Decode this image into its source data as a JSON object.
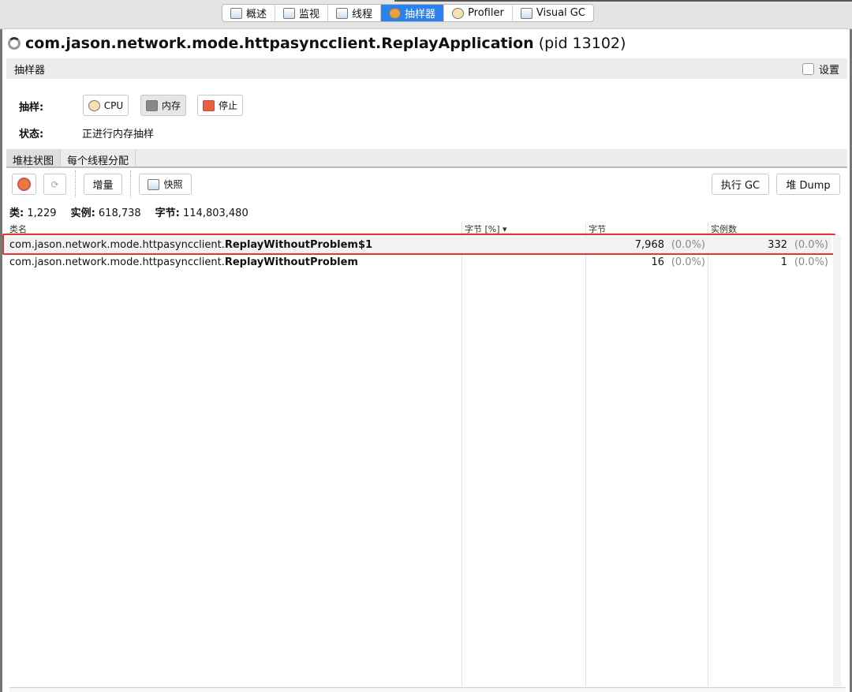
{
  "tabs": [
    {
      "label": "概述",
      "icon": "overview-icon"
    },
    {
      "label": "监视",
      "icon": "monitor-icon"
    },
    {
      "label": "线程",
      "icon": "threads-icon"
    },
    {
      "label": "抽样器",
      "icon": "sampler-icon",
      "active": true
    },
    {
      "label": "Profiler",
      "icon": "profiler-icon"
    },
    {
      "label": "Visual GC",
      "icon": "visualgc-icon"
    }
  ],
  "app": {
    "name": "com.jason.network.mode.httpasyncclient.ReplayApplication",
    "pid": "(pid 13102)"
  },
  "sampler": {
    "header": "抽样器",
    "settings_label": "设置",
    "sample_label": "抽样:",
    "cpu": "CPU",
    "memory": "内存",
    "stop": "停止",
    "status_label": "状态:",
    "status_value": "正进行内存抽样"
  },
  "subtabs": [
    "堆柱状图",
    "每个线程分配"
  ],
  "toolbar": {
    "delta": "增量",
    "snapshot": "快照",
    "gc": "执行 GC",
    "heap_dump": "堆 Dump"
  },
  "stats": {
    "classes_label": "类:",
    "classes": "1,229",
    "instances_label": "实例:",
    "instances": "618,738",
    "bytes_label": "字节:",
    "bytes": "114,803,480"
  },
  "table": {
    "columns": [
      "类名",
      "字节 [%] ▾",
      "字节",
      "实例数"
    ],
    "rows": [
      {
        "pkg": "com.jason.network.mode.httpasyncclient.",
        "cls": "ReplayWithoutProblem$1",
        "bytes": "7,968",
        "bytes_pct": "(0.0%)",
        "instances": "332",
        "inst_pct": "(0.0%)"
      },
      {
        "pkg": "com.jason.network.mode.httpasyncclient.",
        "cls": "ReplayWithoutProblem",
        "bytes": "16",
        "bytes_pct": "(0.0%)",
        "instances": "1",
        "inst_pct": "(0.0%)"
      }
    ]
  },
  "colors": {
    "highlight": "#e8352e",
    "active_tab": "#2b82ee"
  }
}
